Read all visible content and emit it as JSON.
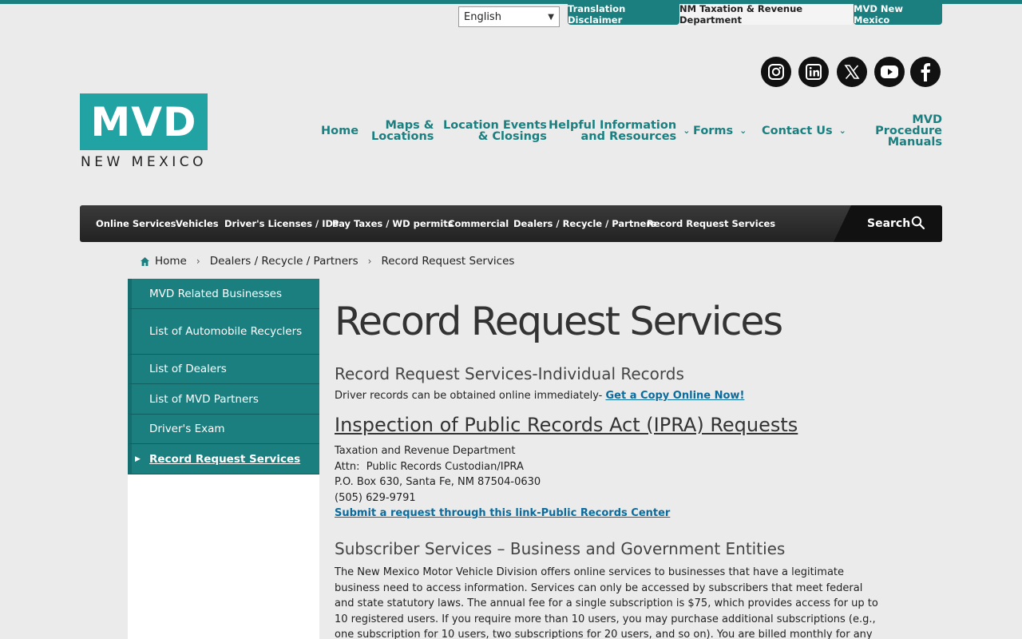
{
  "utility": {
    "language": "English",
    "tabs": [
      "Translation Disclaimer",
      "NM Taxation & Revenue Department",
      "MVD New Mexico"
    ]
  },
  "social": [
    "instagram-icon",
    "linkedin-icon",
    "x-icon",
    "youtube-icon",
    "facebook-icon"
  ],
  "logo": {
    "main": "MVD",
    "sub": "NEW MEXICO"
  },
  "nav": {
    "home": "Home",
    "maps_1": "Maps &",
    "maps_2": "Locations",
    "events_1": "Location Events",
    "events_2": "& Closings",
    "helpful_1": "Helpful Information",
    "helpful_2": "and Resources",
    "forms": "Forms",
    "contact": "Contact Us",
    "manuals_1": "MVD Procedure",
    "manuals_2": "Manuals"
  },
  "menu": {
    "items": [
      "Online Services",
      "Vehicles",
      "Driver's Licenses / IDs",
      "Pay Taxes / WD permits",
      "Commercial",
      "Dealers / Recycle / Partners",
      "Record Request Services"
    ],
    "search": "Search"
  },
  "breadcrumb": [
    "Home",
    "Dealers / Recycle / Partners",
    "Record Request Services"
  ],
  "sidebar": {
    "items": [
      "MVD Related Businesses",
      "List of Automobile Recyclers",
      "List of Dealers",
      "List of MVD Partners",
      "Driver's Exam",
      "Record Request Services"
    ]
  },
  "content": {
    "title": "Record Request Services",
    "section1_heading": "Record Request Services-Individual Records",
    "section1_text": "Driver records can be obtained online immediately-",
    "section1_link": "Get a Copy Online Now!",
    "ipra_heading": "Inspection of Public Records Act (IPRA) Requests",
    "address": [
      "Taxation and Revenue Department",
      "Attn:  Public Records Custodian/IPRA",
      "P.O. Box 630, Santa Fe, NM 87504-0630",
      "(505) 629-9791"
    ],
    "ipra_link": "Submit a request through this link-Public Records Center",
    "subscriber_heading": "Subscriber Services – Business and Government Entities",
    "subscriber_text": "The New Mexico Motor Vehicle Division offers online services to businesses that have a legitimate business need to access information.  Services can only be accessed by subscribers that meet federal and state statutory laws.  The annual fee for a single subscription is $75, which provides access for up to 10 registered users. If you require more than 10 users, you may purchase additional subscriptions (e.g., one subscription for 10 users, two subscriptions for 20 users, and so on).  You are billed monthly for any fees associated with the"
  },
  "colors": {
    "teal": "#1b7f80",
    "logo_teal": "#21a3a3",
    "link": "#0b6b9c"
  }
}
